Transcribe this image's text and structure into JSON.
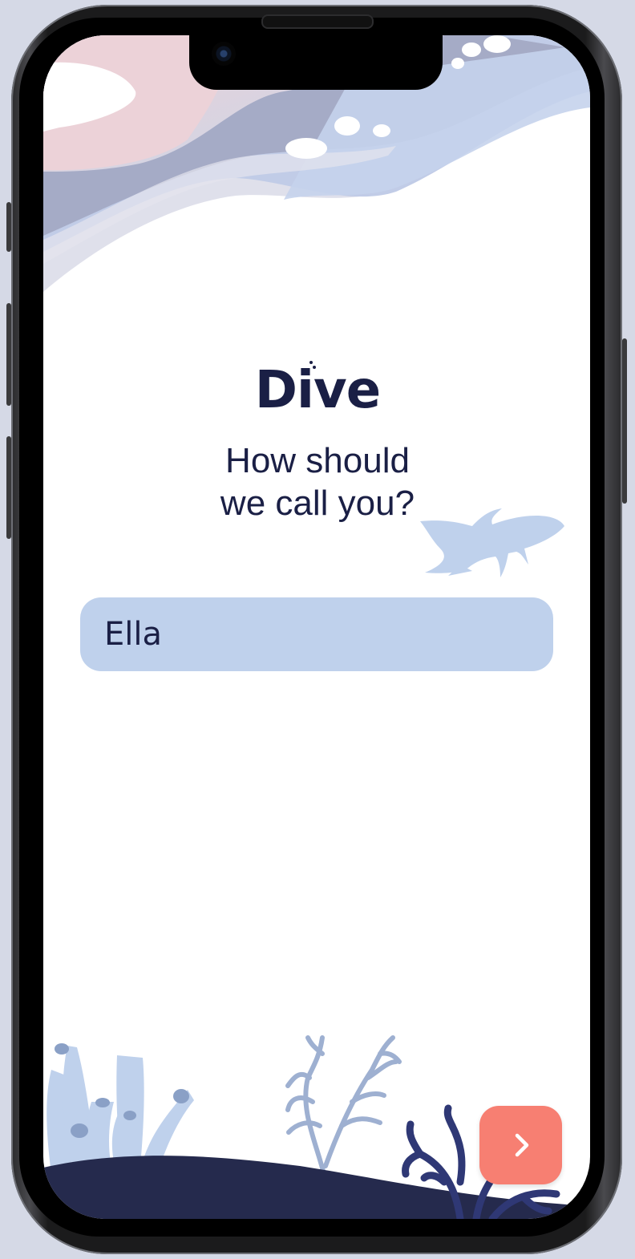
{
  "app": {
    "logo_text": "Dive"
  },
  "onboarding": {
    "question_line1": "How should",
    "question_line2": "we call you?",
    "name_input": {
      "value": "Ella",
      "placeholder": ""
    },
    "next_button": {
      "icon": "chevron-right-icon"
    }
  },
  "colors": {
    "background": "#d5d9e6",
    "text": "#1a1f45",
    "input_fill": "#bfd1ec",
    "accent_button": "#f77f72",
    "seabed": "#252a4d",
    "coral_light": "#bfd1ec"
  }
}
